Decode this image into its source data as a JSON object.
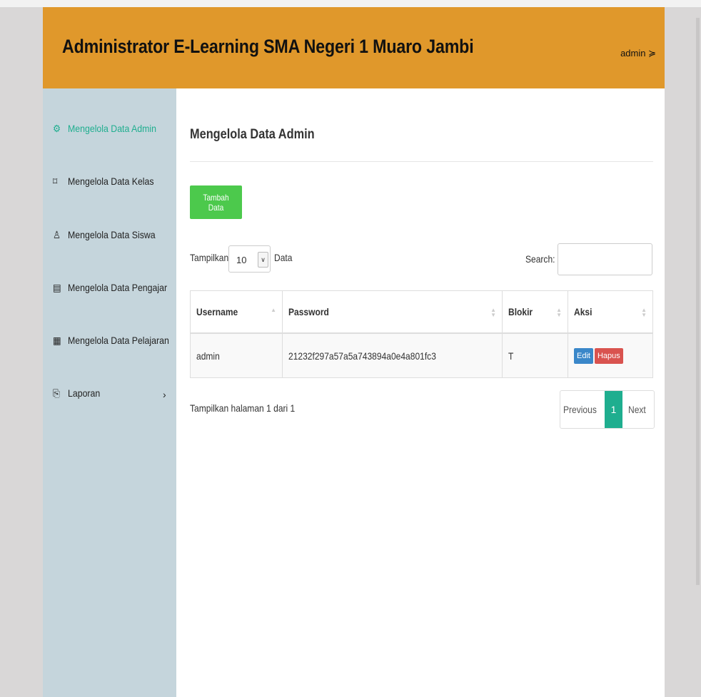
{
  "header": {
    "title": "Administrator E-Learning SMA Negeri 1 Muaro Jambi",
    "user": "admin ≽"
  },
  "sidebar": {
    "items": [
      {
        "icon": "⚙",
        "label": "Mengelola Data Admin"
      },
      {
        "icon": "⌑",
        "label": "Mengelola Data Kelas"
      },
      {
        "icon": "♙",
        "label": "Mengelola Data Siswa"
      },
      {
        "icon": "▤",
        "label": "Mengelola Data Pengajar"
      },
      {
        "icon": "▦",
        "label": "Mengelola Data Pelajaran"
      },
      {
        "icon": "⎘",
        "label": "Laporan",
        "arrow": "›"
      }
    ]
  },
  "main": {
    "title": "Mengelola Data Admin",
    "add_button": "Tambah Data",
    "show_label": "Tampilkan",
    "show_value": "10",
    "show_suffix": "Data",
    "search_label": "Search:",
    "columns": [
      "Username",
      "Password",
      "Blokir",
      "Aksi"
    ],
    "rows": [
      {
        "username": "admin",
        "password": "21232f297a57a5a743894a0e4a801fc3",
        "blokir": "T",
        "edit": "Edit",
        "delete": "Hapus"
      }
    ],
    "info": "Tampilkan halaman 1 dari 1",
    "pagination": {
      "previous": "Previous",
      "current": "1",
      "next": "Next"
    }
  },
  "colors": {
    "header": "#e0982b",
    "sidebar": "#c5d5dc",
    "active": "#1fae8f",
    "add": "#4cc94c",
    "edit": "#3a87c9",
    "delete": "#d9534f"
  }
}
